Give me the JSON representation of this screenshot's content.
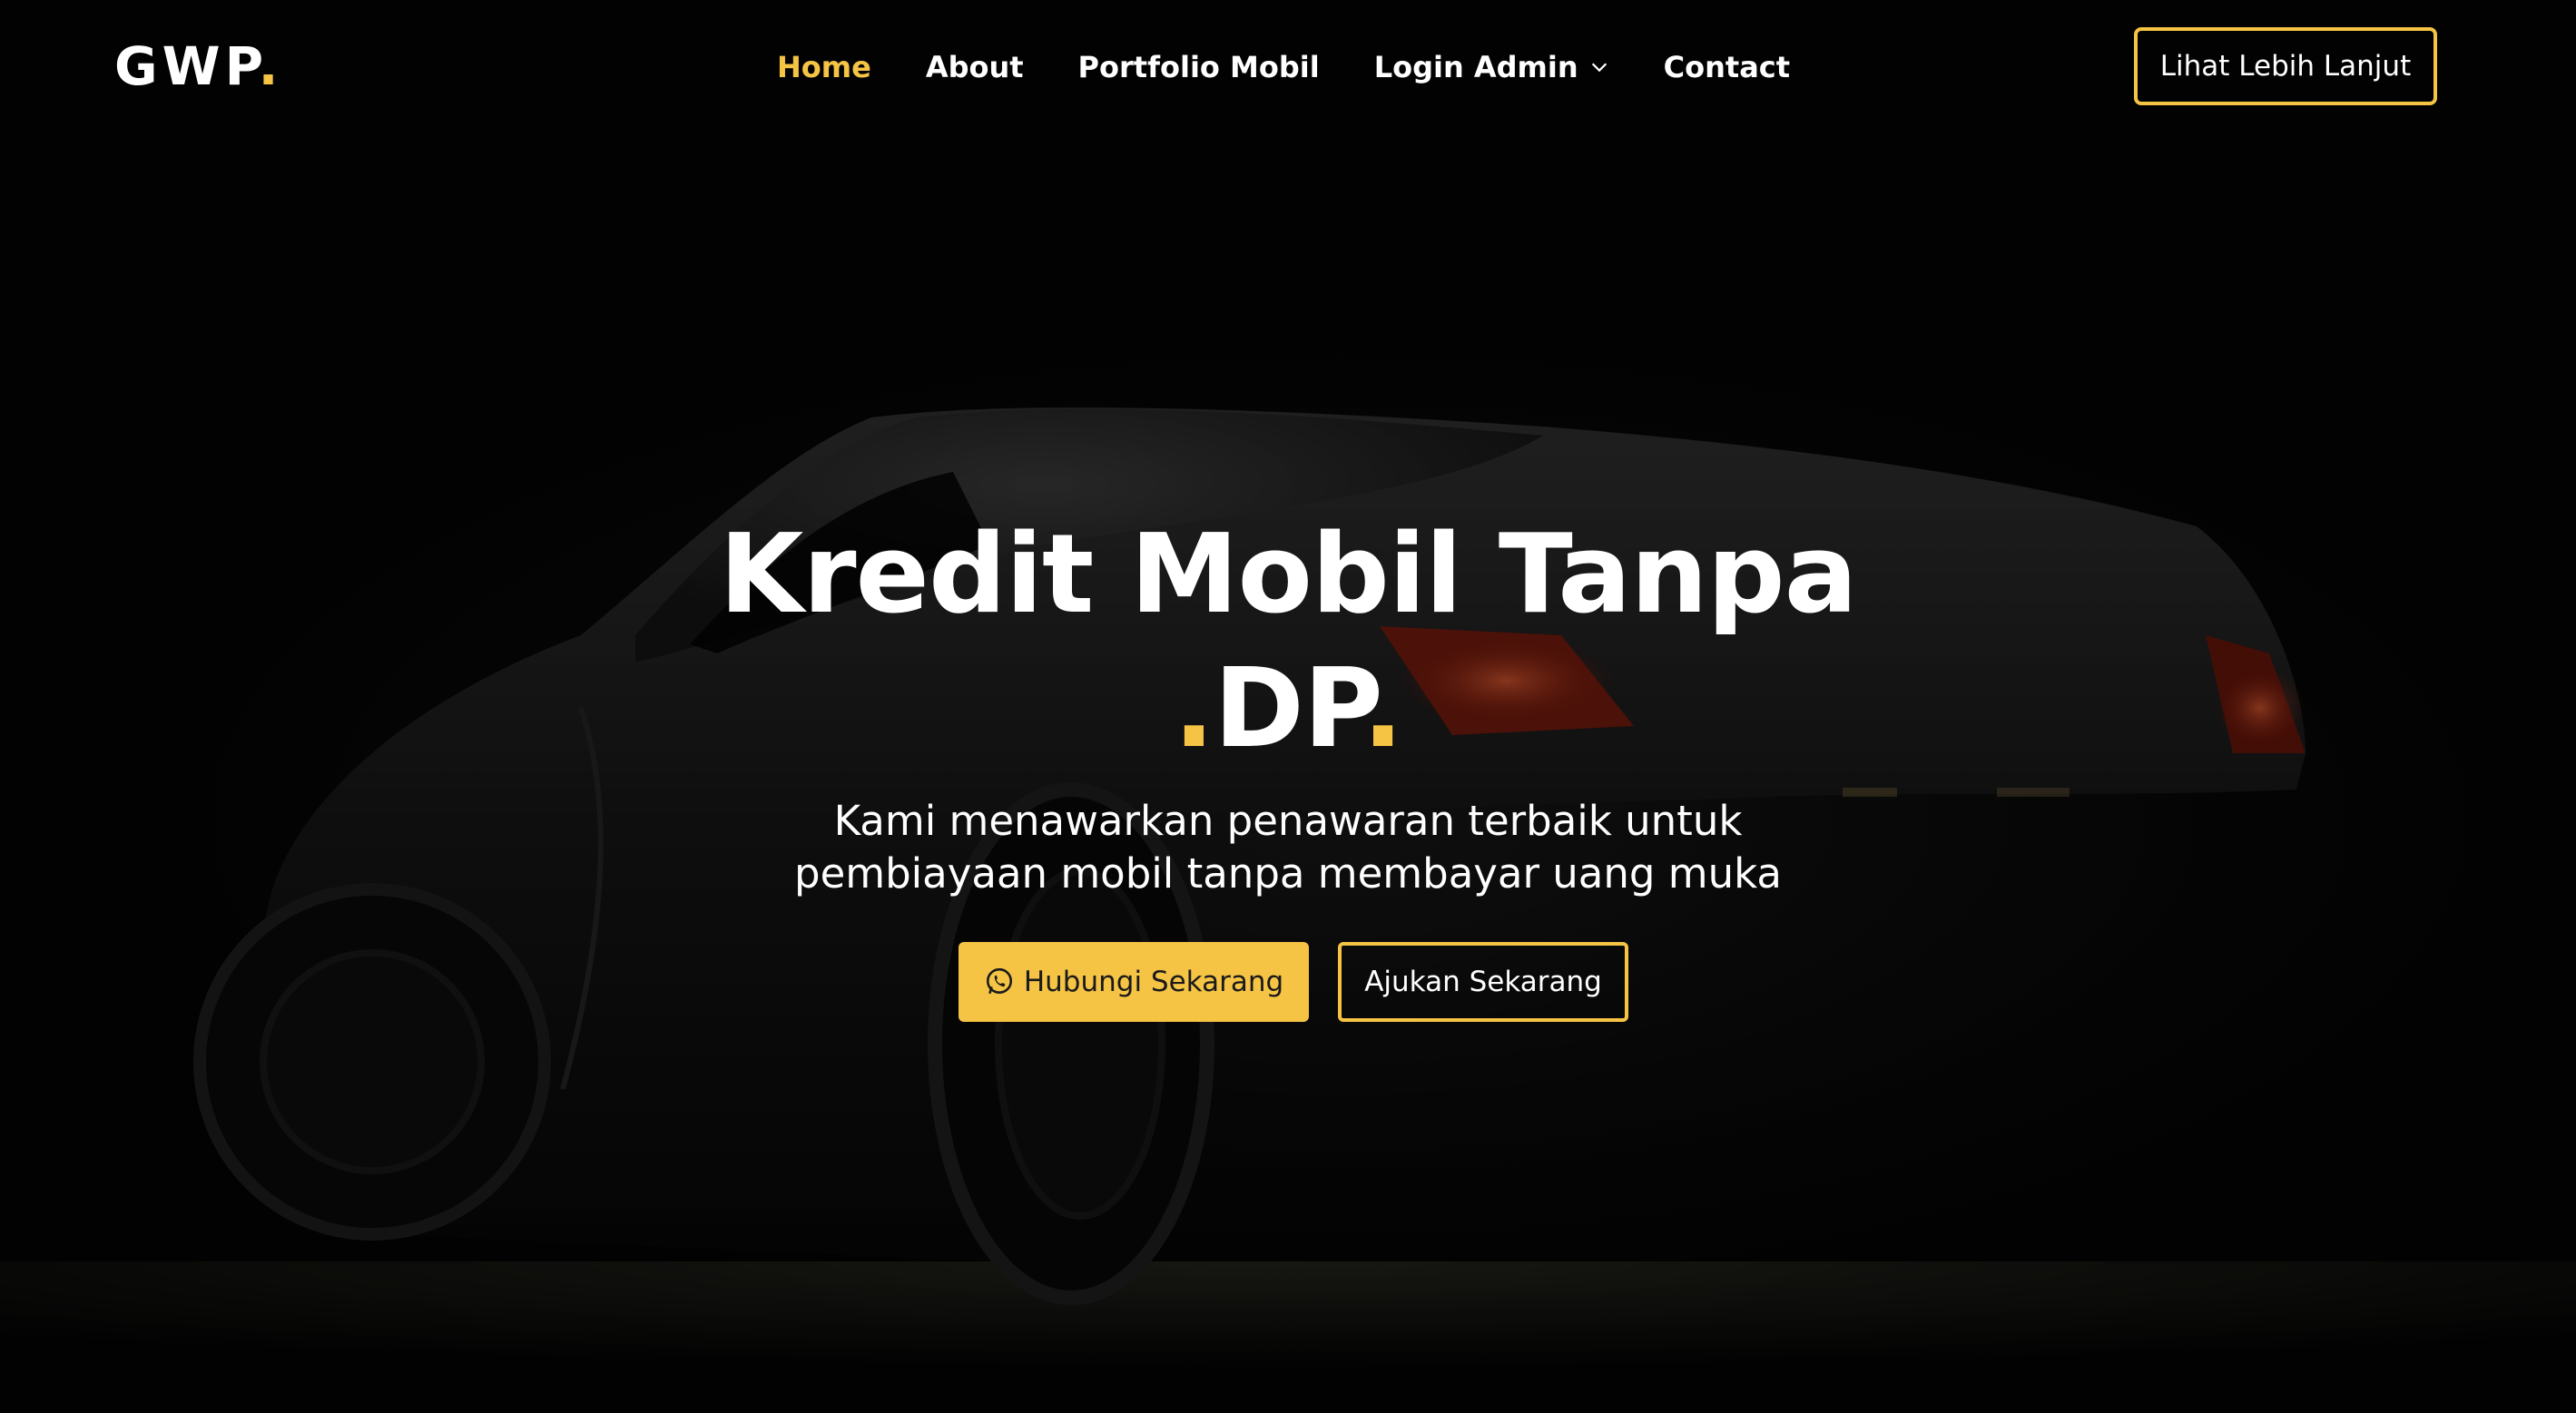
{
  "brand": {
    "name": "GWP",
    "dot": "."
  },
  "nav": {
    "items": [
      {
        "label": "Home",
        "active": true
      },
      {
        "label": "About",
        "active": false
      },
      {
        "label": "Portfolio Mobil",
        "active": false
      },
      {
        "label": "Login Admin",
        "active": false,
        "dropdown": true
      },
      {
        "label": "Contact",
        "active": false
      }
    ],
    "cta_label": "Lihat Lebih Lanjut"
  },
  "hero": {
    "title_line1": "Kredit Mobil Tanpa",
    "title_dot_before": ".",
    "title_word": "DP",
    "title_dot_after": ".",
    "subtitle": "Kami menawarkan penawaran terbaik untuk pembiayaan mobil tanpa membayar uang muka",
    "primary_button": {
      "label": "Hubungi Sekarang",
      "icon": "whatsapp-icon"
    },
    "secondary_button": {
      "label": "Ajukan Sekarang"
    }
  },
  "colors": {
    "accent": "#f6c445",
    "background": "#050505",
    "text": "#ffffff"
  }
}
